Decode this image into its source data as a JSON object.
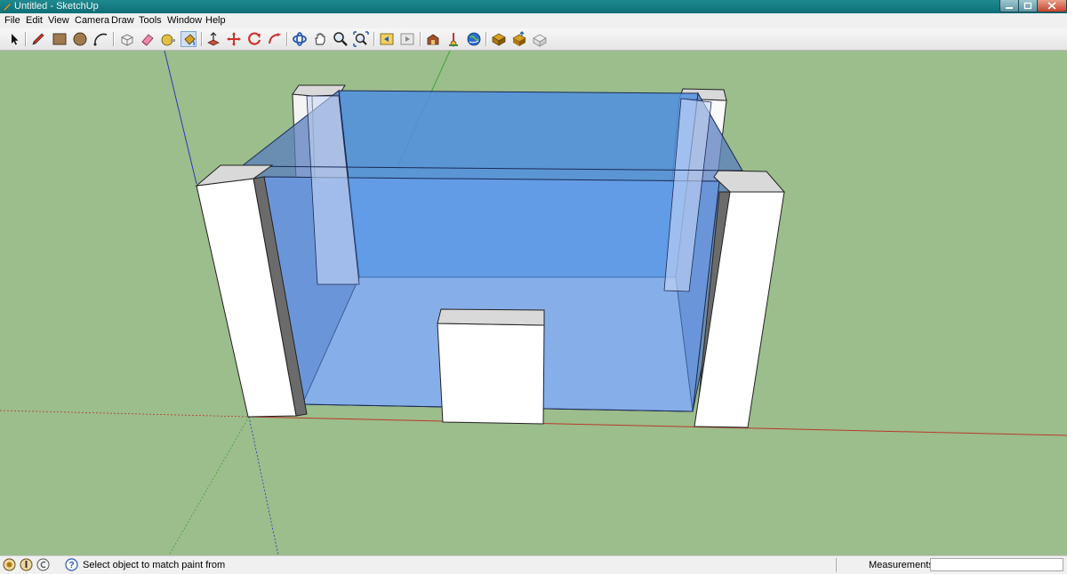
{
  "window": {
    "title": "Untitled - SketchUp"
  },
  "menu": [
    "File",
    "Edit",
    "View",
    "Camera",
    "Draw",
    "Tools",
    "Window",
    "Help"
  ],
  "toolbar": {
    "tools": [
      "select-icon",
      "pencil-icon",
      "rectangle-icon",
      "circle-icon",
      "arc-icon",
      "make-component-icon",
      "eraser-icon",
      "tape-measure-icon",
      "paint-bucket-icon",
      "push-pull-icon",
      "move-icon",
      "rotate-icon",
      "follow-me-icon",
      "orbit-icon",
      "pan-icon",
      "zoom-icon",
      "zoom-extents-icon",
      "previous-view-icon",
      "next-view-icon",
      "get-models-icon",
      "share-model-icon",
      "add-location-icon",
      "google-earth-icon",
      "get-components-icon",
      "share-component-icon",
      "warehouse-icon"
    ]
  },
  "colors": {
    "ground": "#9cbd8c",
    "glass": "#5a8fd8",
    "titlebar": "#1e8a8f"
  },
  "status": {
    "message": "Select object to match paint from",
    "measurements_label": "Measurements",
    "measurements_value": ""
  }
}
